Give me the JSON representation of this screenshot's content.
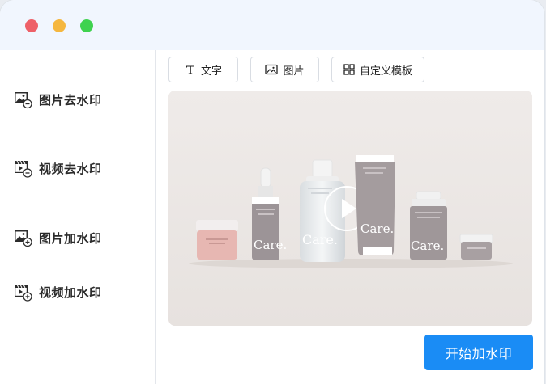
{
  "window": {
    "controls": [
      "close",
      "minimize",
      "maximize"
    ]
  },
  "sidebar": {
    "items": [
      {
        "label": "图片去水印",
        "icon": "image-minus-icon"
      },
      {
        "label": "视频去水印",
        "icon": "video-minus-icon"
      },
      {
        "label": "图片加水印",
        "icon": "image-plus-icon"
      },
      {
        "label": "视频加水印",
        "icon": "video-plus-icon"
      }
    ]
  },
  "toolbar": {
    "text_label": "文字",
    "image_label": "图片",
    "template_label": "自定义模板"
  },
  "preview": {
    "brand_text": "Care.",
    "play_icon": "play-icon"
  },
  "actions": {
    "start_label": "开始加水印"
  },
  "colors": {
    "accent": "#1a8cf5",
    "titlebar": "#f1f6fe",
    "preview_bg": "#ede9e7"
  }
}
